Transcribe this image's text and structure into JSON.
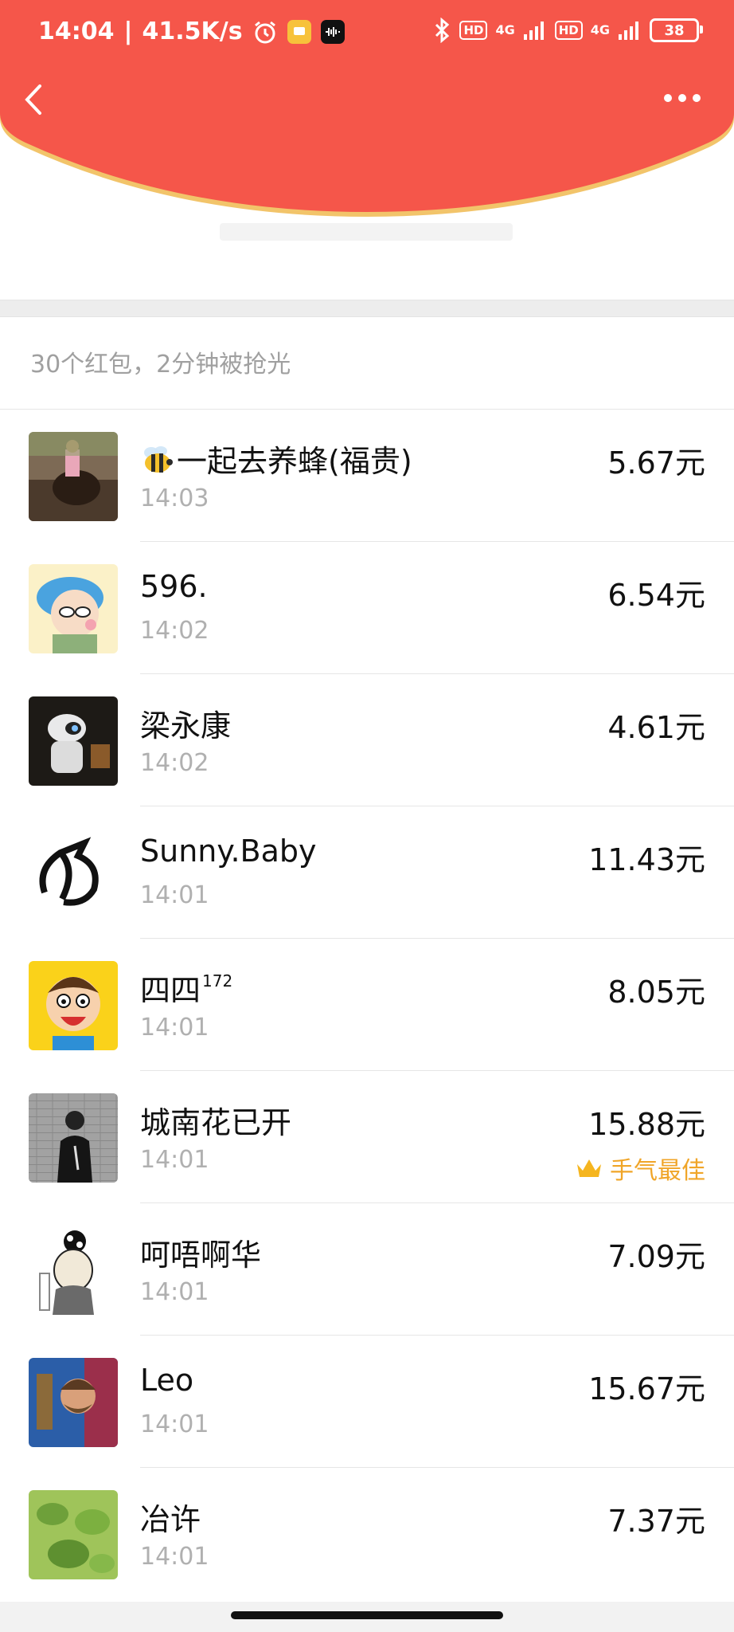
{
  "status_bar": {
    "time": "14:04",
    "separator": "|",
    "net_speed": "41.5K/s",
    "hd1": "HD",
    "net1": "4G",
    "hd2": "HD",
    "net2": "4G",
    "battery": "38"
  },
  "colors": {
    "header_red": "#f5564a",
    "header_rim": "#f2c46a",
    "best_gold": "#f0a528"
  },
  "summary_text": "30个红包，2分钟被抢光",
  "best_label": "手气最佳",
  "entries": [
    {
      "name": "一起去养蜂(福贵)",
      "prefix_icon": "bee-emoji",
      "time": "14:03",
      "amount": "5.67元"
    },
    {
      "name": "596.",
      "time": "14:02",
      "amount": "6.54元"
    },
    {
      "name": "梁永康",
      "time": "14:02",
      "amount": "4.61元"
    },
    {
      "name": "Sunny.Baby",
      "time": "14:01",
      "amount": "11.43元"
    },
    {
      "name": "四四",
      "name_sup": "172",
      "time": "14:01",
      "amount": "8.05元"
    },
    {
      "name": "城南花已开",
      "time": "14:01",
      "amount": "15.88元",
      "best": true
    },
    {
      "name": "呵唔啊华",
      "time": "14:01",
      "amount": "7.09元"
    },
    {
      "name": "Leo",
      "time": "14:01",
      "amount": "15.67元"
    },
    {
      "name": "冶许",
      "time": "14:01",
      "amount": "7.37元"
    }
  ]
}
